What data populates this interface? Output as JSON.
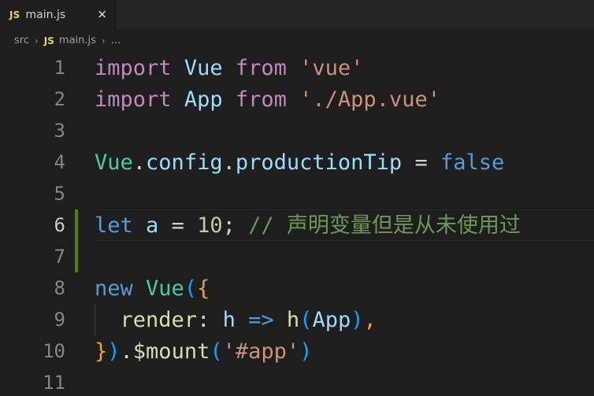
{
  "colors": {
    "editor_background": "#1e1e1e",
    "tabbar_background": "#252526",
    "accent_js": "#e8d44d",
    "git_modified": "#587c0c",
    "keyword": "#c586c0",
    "keyword_control": "#569cd6",
    "type": "#4ec9b0",
    "variable": "#9cdcfe",
    "string": "#ce9178",
    "number": "#b5cea8",
    "comment": "#6a9955",
    "function": "#dcdcaa"
  },
  "tab": {
    "icon": "JS",
    "icon_name": "javascript-file-icon",
    "label": "main.js",
    "close": "✕"
  },
  "breadcrumb": {
    "items": [
      "src",
      "main.js",
      "..."
    ],
    "icon": "JS",
    "separator": "›"
  },
  "editor": {
    "active_line": 6,
    "lines": [
      {
        "n": "1",
        "changed": false,
        "indent_guide": false,
        "text": "import Vue from 'vue'",
        "tokens": [
          {
            "t": "import",
            "c": "kw"
          },
          {
            "t": " ",
            "c": "pun"
          },
          {
            "t": "Vue",
            "c": "var"
          },
          {
            "t": " ",
            "c": "pun"
          },
          {
            "t": "from",
            "c": "kw"
          },
          {
            "t": " ",
            "c": "pun"
          },
          {
            "t": "'vue'",
            "c": "str"
          }
        ]
      },
      {
        "n": "2",
        "changed": false,
        "indent_guide": false,
        "text": "import App from './App.vue'",
        "tokens": [
          {
            "t": "import",
            "c": "kw"
          },
          {
            "t": " ",
            "c": "pun"
          },
          {
            "t": "App",
            "c": "var"
          },
          {
            "t": " ",
            "c": "pun"
          },
          {
            "t": "from",
            "c": "kw"
          },
          {
            "t": " ",
            "c": "pun"
          },
          {
            "t": "'./App.vue'",
            "c": "str"
          }
        ]
      },
      {
        "n": "3",
        "changed": false,
        "indent_guide": false,
        "text": "",
        "tokens": []
      },
      {
        "n": "4",
        "changed": false,
        "indent_guide": false,
        "text": "Vue.config.productionTip = false",
        "tokens": [
          {
            "t": "Vue",
            "c": "cls"
          },
          {
            "t": ".",
            "c": "pun"
          },
          {
            "t": "config",
            "c": "var"
          },
          {
            "t": ".",
            "c": "pun"
          },
          {
            "t": "productionTip",
            "c": "var"
          },
          {
            "t": " ",
            "c": "pun"
          },
          {
            "t": "=",
            "c": "pun"
          },
          {
            "t": " ",
            "c": "pun"
          },
          {
            "t": "false",
            "c": "kwb"
          }
        ]
      },
      {
        "n": "5",
        "changed": false,
        "indent_guide": false,
        "text": "",
        "tokens": []
      },
      {
        "n": "6",
        "changed": true,
        "indent_guide": false,
        "text": "let a = 10; // 声明变量但是从未使用过",
        "tokens": [
          {
            "t": "let",
            "c": "kwb"
          },
          {
            "t": " ",
            "c": "pun"
          },
          {
            "t": "a",
            "c": "var"
          },
          {
            "t": " ",
            "c": "pun"
          },
          {
            "t": "=",
            "c": "pun"
          },
          {
            "t": " ",
            "c": "pun"
          },
          {
            "t": "10",
            "c": "num"
          },
          {
            "t": ";",
            "c": "pun"
          },
          {
            "t": " ",
            "c": "pun"
          },
          {
            "t": "// ",
            "c": "cmt-slash"
          },
          {
            "t": "声明变量但是从未使用过",
            "c": "cmt"
          }
        ]
      },
      {
        "n": "7",
        "changed": true,
        "indent_guide": false,
        "text": "",
        "tokens": []
      },
      {
        "n": "8",
        "changed": false,
        "indent_guide": false,
        "text": "new Vue({",
        "tokens": [
          {
            "t": "new",
            "c": "kwb"
          },
          {
            "t": " ",
            "c": "pun"
          },
          {
            "t": "Vue",
            "c": "cls"
          },
          {
            "t": "(",
            "c": "br3"
          },
          {
            "t": "{",
            "c": "bro"
          }
        ]
      },
      {
        "n": "9",
        "changed": false,
        "indent_guide": true,
        "text": "  render: h => h(App),",
        "tokens": [
          {
            "t": "  ",
            "c": "pun"
          },
          {
            "t": "render",
            "c": "fn"
          },
          {
            "t": ":",
            "c": "pun"
          },
          {
            "t": " ",
            "c": "pun"
          },
          {
            "t": "h",
            "c": "var"
          },
          {
            "t": " ",
            "c": "pun"
          },
          {
            "t": "=>",
            "c": "kwb"
          },
          {
            "t": " ",
            "c": "pun"
          },
          {
            "t": "h",
            "c": "fn"
          },
          {
            "t": "(",
            "c": "br3"
          },
          {
            "t": "App",
            "c": "var"
          },
          {
            "t": ")",
            "c": "br3"
          },
          {
            "t": ",",
            "c": "bro"
          }
        ]
      },
      {
        "n": "10",
        "changed": false,
        "indent_guide": false,
        "text": "}).$mount('#app')",
        "tokens": [
          {
            "t": "}",
            "c": "bro"
          },
          {
            "t": ")",
            "c": "br3"
          },
          {
            "t": ".",
            "c": "pun"
          },
          {
            "t": "$mount",
            "c": "fn"
          },
          {
            "t": "(",
            "c": "br3"
          },
          {
            "t": "'#app'",
            "c": "str"
          },
          {
            "t": ")",
            "c": "br3"
          }
        ]
      },
      {
        "n": "11",
        "changed": false,
        "indent_guide": false,
        "text": "",
        "tokens": []
      }
    ]
  }
}
